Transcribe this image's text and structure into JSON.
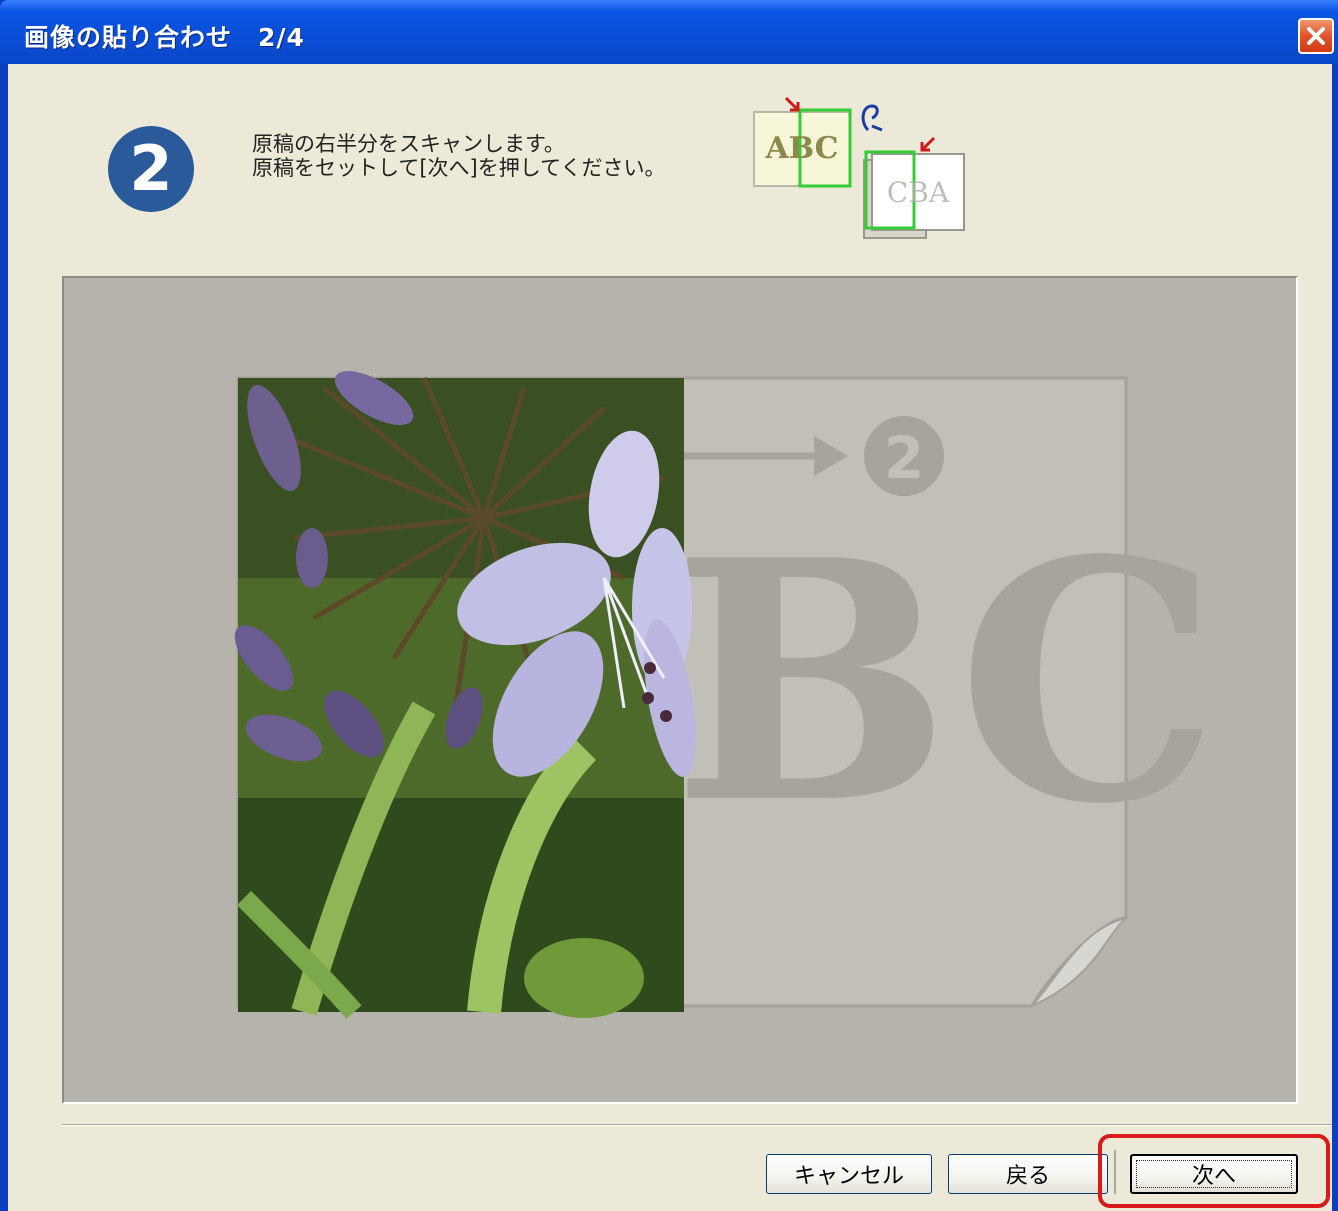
{
  "window": {
    "title": "画像の貼り合わせ　2/4"
  },
  "step": {
    "number": "2",
    "line1": "原稿の右半分をスキャンします。",
    "line2": "原稿をセットして[次へ]を押してください。"
  },
  "illustration": {
    "page1_text": "ABC",
    "page2_text": "CBA"
  },
  "preview": {
    "guide_letters": "BC",
    "guide_step": "2"
  },
  "buttons": {
    "cancel": "キャンセル",
    "back": "戻る",
    "next": "次へ"
  },
  "colors": {
    "titlebar": "#0a54e3",
    "step_circle": "#2a5a9a",
    "highlight": "#d81a1a",
    "scan_frame": "#33cc33"
  },
  "icons": {
    "close": "close-icon",
    "step": "step-2-badge",
    "illustration": "scan-orientation-icon"
  }
}
